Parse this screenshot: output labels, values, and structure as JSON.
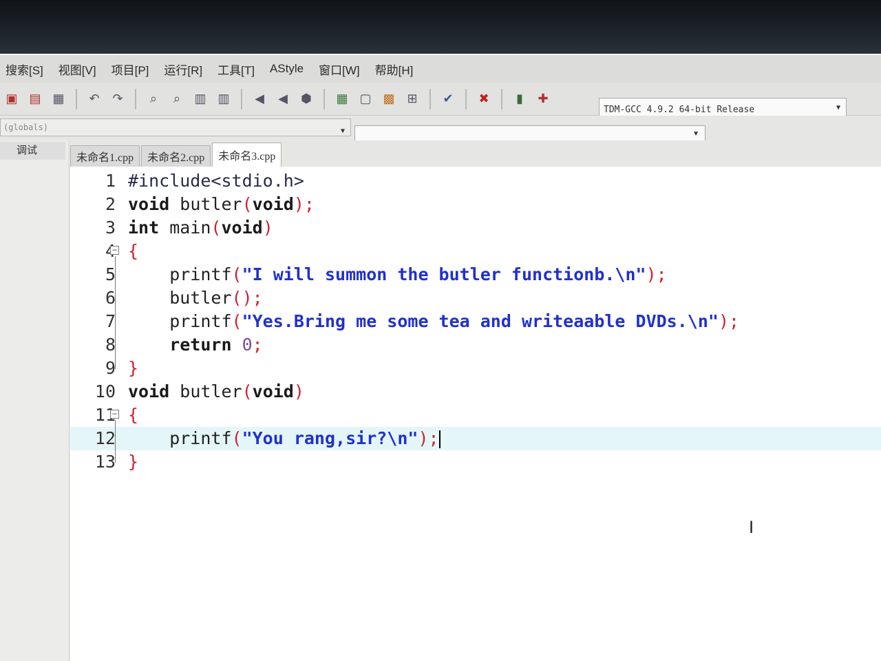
{
  "menubar": {
    "items": [
      "搜索[S]",
      "视图[V]",
      "项目[P]",
      "运行[R]",
      "工具[T]",
      "AStyle",
      "窗口[W]",
      "帮助[H]"
    ]
  },
  "toolbar": {
    "compiler": "TDM-GCC 4.9.2 64-bit Release"
  },
  "scope": {
    "value": "(globals)"
  },
  "side_panel": {
    "tab_label": "调试"
  },
  "tabs": [
    "未命名1.cpp",
    "未命名2.cpp",
    "未命名3.cpp"
  ],
  "active_tab": 2,
  "editor": {
    "lines": [
      {
        "n": "1",
        "tokens": [
          {
            "t": "#include<stdio.h>",
            "c": "inc"
          }
        ]
      },
      {
        "n": "2",
        "tokens": [
          {
            "t": "void",
            "c": "kw"
          },
          {
            "t": " butler",
            "c": ""
          },
          {
            "t": "(",
            "c": "pn"
          },
          {
            "t": "void",
            "c": "kw"
          },
          {
            "t": ");",
            "c": "pn"
          }
        ]
      },
      {
        "n": "3",
        "tokens": [
          {
            "t": "int",
            "c": "kw"
          },
          {
            "t": " main",
            "c": ""
          },
          {
            "t": "(",
            "c": "pn"
          },
          {
            "t": "void",
            "c": "kw"
          },
          {
            "t": ")",
            "c": "pn"
          }
        ]
      },
      {
        "n": "4",
        "fold": true,
        "tokens": [
          {
            "t": "{",
            "c": "pn"
          }
        ]
      },
      {
        "n": "5",
        "tokens": [
          {
            "t": "    printf",
            "c": ""
          },
          {
            "t": "(",
            "c": "pn"
          },
          {
            "t": "\"I will summon the butler functionb.\\n\"",
            "c": "str"
          },
          {
            "t": ");",
            "c": "pn"
          }
        ]
      },
      {
        "n": "6",
        "tokens": [
          {
            "t": "    butler",
            "c": ""
          },
          {
            "t": "();",
            "c": "pn"
          }
        ]
      },
      {
        "n": "7",
        "tokens": [
          {
            "t": "    printf",
            "c": ""
          },
          {
            "t": "(",
            "c": "pn"
          },
          {
            "t": "\"Yes.Bring me some tea and writeaable DVDs.\\n\"",
            "c": "str"
          },
          {
            "t": ");",
            "c": "pn"
          }
        ]
      },
      {
        "n": "8",
        "tokens": [
          {
            "t": "    return",
            "c": "kw"
          },
          {
            "t": " 0",
            "c": "num"
          },
          {
            "t": ";",
            "c": "pn"
          }
        ]
      },
      {
        "n": "9",
        "tokens": [
          {
            "t": "}",
            "c": "pn"
          }
        ]
      },
      {
        "n": "10",
        "tokens": [
          {
            "t": "void",
            "c": "kw"
          },
          {
            "t": " butler",
            "c": ""
          },
          {
            "t": "(",
            "c": "pn"
          },
          {
            "t": "void",
            "c": "kw"
          },
          {
            "t": ")",
            "c": "pn"
          }
        ]
      },
      {
        "n": "11",
        "fold": true,
        "tokens": [
          {
            "t": "{",
            "c": "pn"
          }
        ]
      },
      {
        "n": "12",
        "current": true,
        "tokens": [
          {
            "t": "    printf",
            "c": ""
          },
          {
            "t": "(",
            "c": "pn"
          },
          {
            "t": "\"You rang,sir?\\n\"",
            "c": "str"
          },
          {
            "t": ");",
            "c": "pn"
          }
        ]
      },
      {
        "n": "13",
        "tokens": [
          {
            "t": "}",
            "c": "pn"
          }
        ]
      }
    ]
  },
  "icons": {
    "toolbar": [
      "new-file-icon",
      "open-icon",
      "save-icon",
      "undo-icon",
      "redo-icon",
      "find-icon",
      "replace-icon",
      "indent-icon",
      "unindent-icon",
      "bookmark-prev-icon",
      "bookmark-next-icon",
      "toggle-icon",
      "layout-icon",
      "window-icon",
      "color-icon",
      "grid-icon",
      "compile-icon",
      "stop-icon",
      "chart-icon",
      "debug-icon"
    ]
  }
}
